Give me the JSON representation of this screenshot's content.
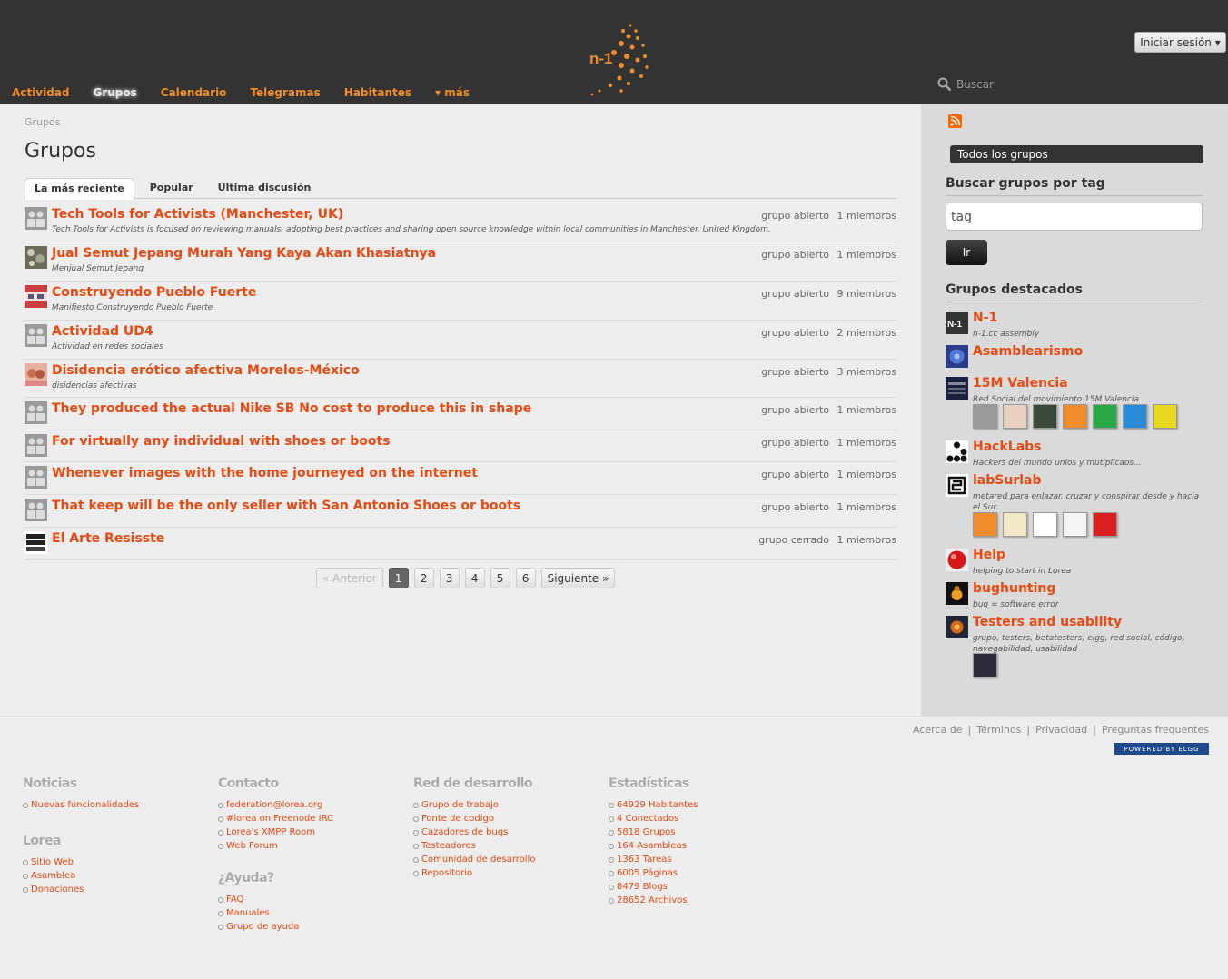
{
  "header": {
    "login_label": "Iniciar sesión ▾",
    "search_placeholder": "Buscar",
    "nav": [
      "Actividad",
      "Grupos",
      "Calendario",
      "Telegramas",
      "Habitantes",
      "▾ más"
    ]
  },
  "main": {
    "breadcrumb": "Grupos",
    "title": "Grupos",
    "tabs": [
      "La más reciente",
      "Popular",
      "Ultima discusión"
    ],
    "groups": [
      {
        "title": "Tech Tools for Activists (Manchester, UK)",
        "desc": "Tech Tools for Activists is focused on reviewing manuals, adopting best practices and sharing open source knowledge within local communities in Manchester, United Kingdom.",
        "type": "grupo abierto",
        "members": "1 miembros"
      },
      {
        "title": "Jual Semut Jepang Murah Yang Kaya Akan Khasiatnya",
        "desc": "Menjual Semut Jepang",
        "type": "grupo abierto",
        "members": "1 miembros"
      },
      {
        "title": "Construyendo Pueblo Fuerte",
        "desc": "Manifiesto Construyendo Pueblo Fuerte",
        "type": "grupo abierto",
        "members": "9 miembros"
      },
      {
        "title": "Actividad UD4",
        "desc": "Actividad en redes sociales",
        "type": "grupo abierto",
        "members": "2 miembros"
      },
      {
        "title": "Disidencia erótico afectiva Morelos-México",
        "desc": "disidencias afectivas",
        "type": "grupo abierto",
        "members": "3 miembros"
      },
      {
        "title": "They produced the actual Nike SB No cost to produce this in shape",
        "desc": "",
        "type": "grupo abierto",
        "members": "1 miembros"
      },
      {
        "title": "For virtually any individual with shoes or boots",
        "desc": "",
        "type": "grupo abierto",
        "members": "1 miembros"
      },
      {
        "title": "Whenever images with the home journeyed on the internet",
        "desc": "",
        "type": "grupo abierto",
        "members": "1 miembros"
      },
      {
        "title": "That keep will be the only seller with San Antonio Shoes or boots",
        "desc": "",
        "type": "grupo abierto",
        "members": "1 miembros"
      },
      {
        "title": "El Arte Resisste",
        "desc": "",
        "type": "grupo cerrado",
        "members": "1 miembros"
      }
    ],
    "pagination": {
      "prev": "« Anterior",
      "pages": [
        "1",
        "2",
        "3",
        "4",
        "5",
        "6"
      ],
      "next": "Siguiente »"
    }
  },
  "sidebar": {
    "all_groups": "Todos los grupos",
    "tag_heading": "Buscar grupos por tag",
    "tag_value": "tag",
    "go_label": "Ir",
    "featured_heading": "Grupos destacados",
    "featured": [
      {
        "title": "N-1",
        "desc": "n-1.cc assembly"
      },
      {
        "title": "Asamblearismo",
        "desc": ""
      },
      {
        "title": "15M Valencia",
        "desc": "Red Social del movimiento 15M Valencia"
      },
      {
        "title": "HackLabs",
        "desc": "Hackers del mundo unios y mutiplicaos..."
      },
      {
        "title": "labSurlab",
        "desc": "metared para enlazar, cruzar y conspirar desde y hacia el Sur."
      },
      {
        "title": "Help",
        "desc": "helping to start in Lorea"
      },
      {
        "title": "bughunting",
        "desc": "bug = software error"
      },
      {
        "title": "Testers and usability",
        "desc": "grupo, testers, betatesters, elgg, red social, código, navegabilidad, usabilidad"
      }
    ]
  },
  "footer": {
    "links": [
      "Acerca de",
      "Términos",
      "Privacidad",
      "Preguntas frequentes"
    ],
    "elgg": "POWERED BY ELGG",
    "noticias": {
      "title": "Noticias",
      "items": [
        "Nuevas funcionalidades"
      ]
    },
    "lorea": {
      "title": "Lorea",
      "items": [
        "Sitio Web",
        "Asamblea",
        "Donaciones"
      ]
    },
    "contacto": {
      "title": "Contacto",
      "items": [
        "federation@lorea.org",
        "#lorea on Freenode IRC",
        "Lorea's XMPP Room",
        "Web Forum"
      ]
    },
    "ayuda": {
      "title": "¿Ayuda?",
      "items": [
        "FAQ",
        "Manuales",
        "Grupo de ayuda"
      ]
    },
    "red": {
      "title": "Red de desarrollo",
      "items": [
        "Grupo de trabajo",
        "Fonte de codigo",
        "Cazadores de bugs",
        "Testeadores",
        "Comunidad de desarrollo",
        "Repositorio"
      ]
    },
    "stats": {
      "title": "Estadísticas",
      "items": [
        "64929 Habitantes",
        "4 Conectados",
        "5818 Grupos",
        "164 Asambleas",
        "1363 Tareas",
        "6005 Páginas",
        "8479 Blogs",
        "28652 Archivos"
      ]
    }
  }
}
